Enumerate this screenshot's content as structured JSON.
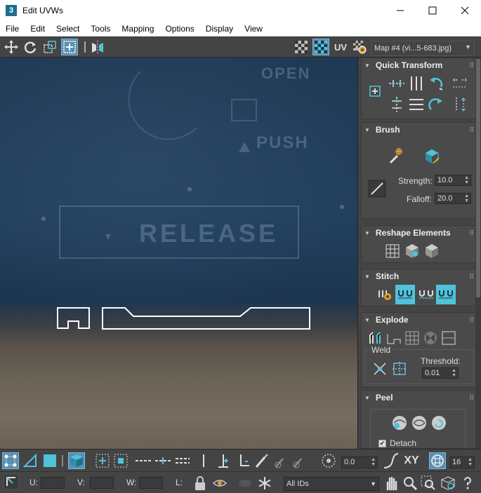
{
  "window": {
    "app_icon_text": "3",
    "title": "Edit UVWs",
    "minimize_glyph": "—",
    "maximize_glyph": "☐",
    "close_glyph": "✕"
  },
  "menu": {
    "items": [
      "File",
      "Edit",
      "Select",
      "Tools",
      "Mapping",
      "Options",
      "Display",
      "View"
    ]
  },
  "toolbar": {
    "uv_label": "UV",
    "map_dropdown": "Map #4 (vi...5-683.jpg)",
    "map_dropdown_arrow": "▼"
  },
  "viewport": {
    "background_texts": [
      "OPEN",
      "PUSH",
      "RELEASE"
    ]
  },
  "panel": {
    "quick_transform": {
      "title": "Quick Transform"
    },
    "brush": {
      "title": "Brush",
      "strength_label": "Strength:",
      "strength_value": "10.0",
      "falloff_label": "Falloff:",
      "falloff_value": "20.0"
    },
    "reshape": {
      "title": "Reshape Elements"
    },
    "stitch": {
      "title": "Stitch"
    },
    "explode": {
      "title": "Explode",
      "weld_label": "Weld",
      "threshold_label": "Threshold:",
      "threshold_value": "0.01"
    },
    "peel": {
      "title": "Peel",
      "detach_label": "Detach",
      "detach_checked": true
    }
  },
  "bottom": {
    "rotate_value": "0.0",
    "xy_label": "XY",
    "grid_value": "16",
    "u_label": "U:",
    "v_label": "V:",
    "w_label": "W:",
    "l_label": "L:",
    "ids_dropdown": "All IDs",
    "ids_arrow": "▼"
  },
  "colors": {
    "accent": "#5a8fb3",
    "icon_teal": "#4fc3d9",
    "panel_bg": "#444444",
    "uv_outline": "#ffffff"
  }
}
